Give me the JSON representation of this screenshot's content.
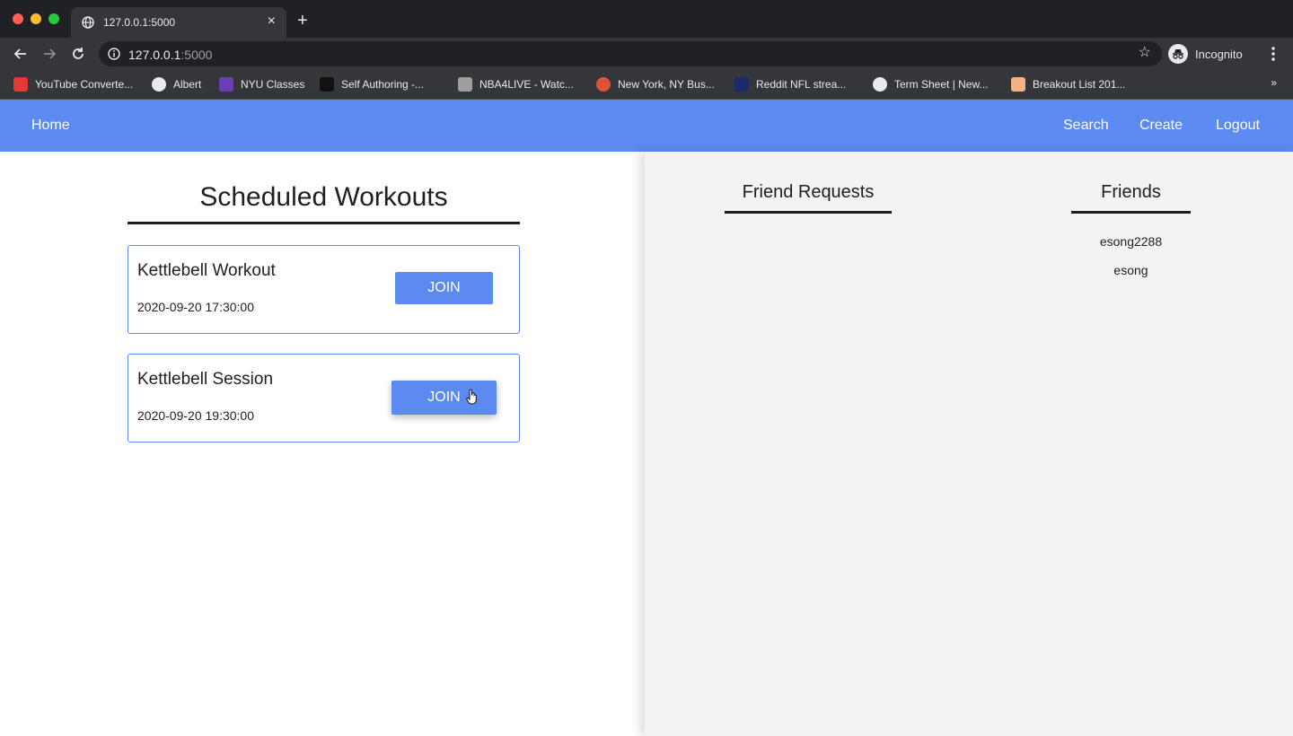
{
  "browser": {
    "tab_title": "127.0.0.1:5000",
    "url_host": "127.0.0.1",
    "url_port": ":5000",
    "profile_label": "Incognito",
    "bookmarks": [
      {
        "label": "YouTube Converte...",
        "color": "#e53935"
      },
      {
        "label": "Albert",
        "color": "#e8eaed"
      },
      {
        "label": "NYU Classes",
        "color": "#6a3fb5"
      },
      {
        "label": "Self Authoring -...",
        "color": "#111111"
      },
      {
        "label": "NBA4LIVE - Watc...",
        "color": "#9e9e9e"
      },
      {
        "label": "New York, NY Bus...",
        "color": "#e0533b"
      },
      {
        "label": "Reddit NFL strea...",
        "color": "#1a2a6c"
      },
      {
        "label": "Term Sheet | New...",
        "color": "#e8eaed"
      },
      {
        "label": "Breakout List 201...",
        "color": "#f4b183"
      }
    ],
    "more_bookmarks": "»"
  },
  "navbar": {
    "home": "Home",
    "search": "Search",
    "create": "Create",
    "logout": "Logout"
  },
  "scheduled": {
    "title": "Scheduled Workouts",
    "workouts": [
      {
        "name": "Kettlebell Workout",
        "time": "2020-09-20 17:30:00",
        "button": "JOIN"
      },
      {
        "name": "Kettlebell Session",
        "time": "2020-09-20 19:30:00",
        "button": "JOIN"
      }
    ]
  },
  "friend_requests": {
    "title": "Friend Requests"
  },
  "friends": {
    "title": "Friends",
    "list": [
      "esong2288",
      "esong"
    ]
  },
  "colors": {
    "accent": "#5b8af0"
  }
}
